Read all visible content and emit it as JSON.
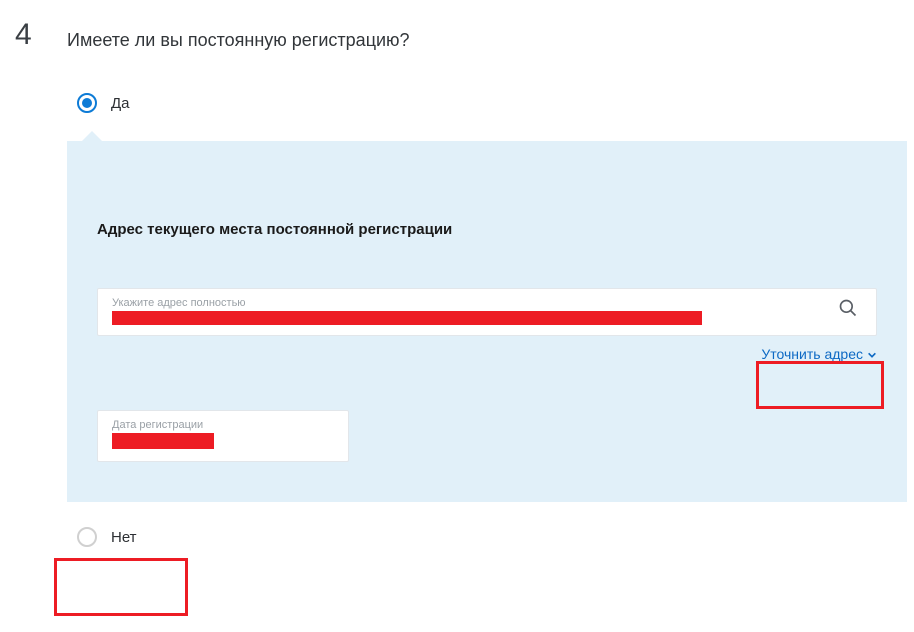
{
  "step": {
    "number": "4",
    "title": "Имеете ли вы постоянную регистрацию?"
  },
  "options": {
    "yes_label": "Да",
    "no_label": "Нет"
  },
  "panel": {
    "heading": "Адрес текущего места постоянной регистрации",
    "address_label": "Укажите адрес полностью",
    "refine_link": "Уточнить адрес",
    "date_label": "Дата регистрации"
  }
}
